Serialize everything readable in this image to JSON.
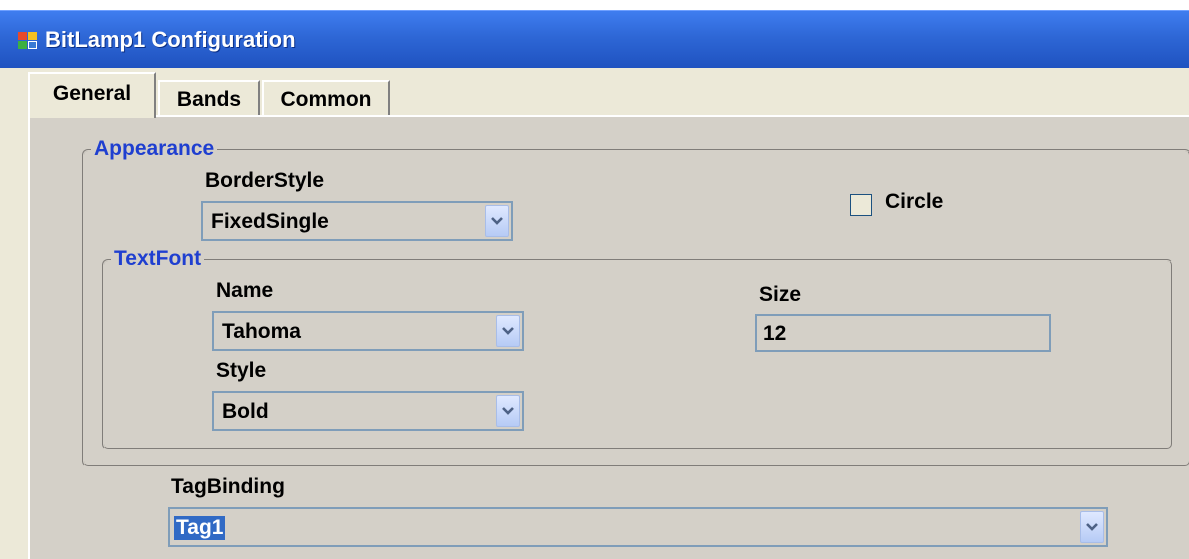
{
  "window": {
    "title": "BitLamp1 Configuration",
    "icon": "app-window-icon"
  },
  "tabs": [
    {
      "label": "General",
      "active": true
    },
    {
      "label": "Bands",
      "active": false
    },
    {
      "label": "Common",
      "active": false
    }
  ],
  "appearance": {
    "group_title": "Appearance",
    "border_style_label": "BorderStyle",
    "border_style_value": "FixedSingle",
    "circle_label": "Circle",
    "circle_checked": false
  },
  "text_font": {
    "group_title": "TextFont",
    "name_label": "Name",
    "name_value": "Tahoma",
    "size_label": "Size",
    "size_value": "12",
    "style_label": "Style",
    "style_value": "Bold"
  },
  "tag_binding": {
    "label": "TagBinding",
    "value": "Tag1"
  },
  "colors": {
    "titlebar": "#2e67d6",
    "group_title": "#1f3fd0",
    "dialog_bg": "#d4d0c8",
    "selection": "#316ac5"
  }
}
